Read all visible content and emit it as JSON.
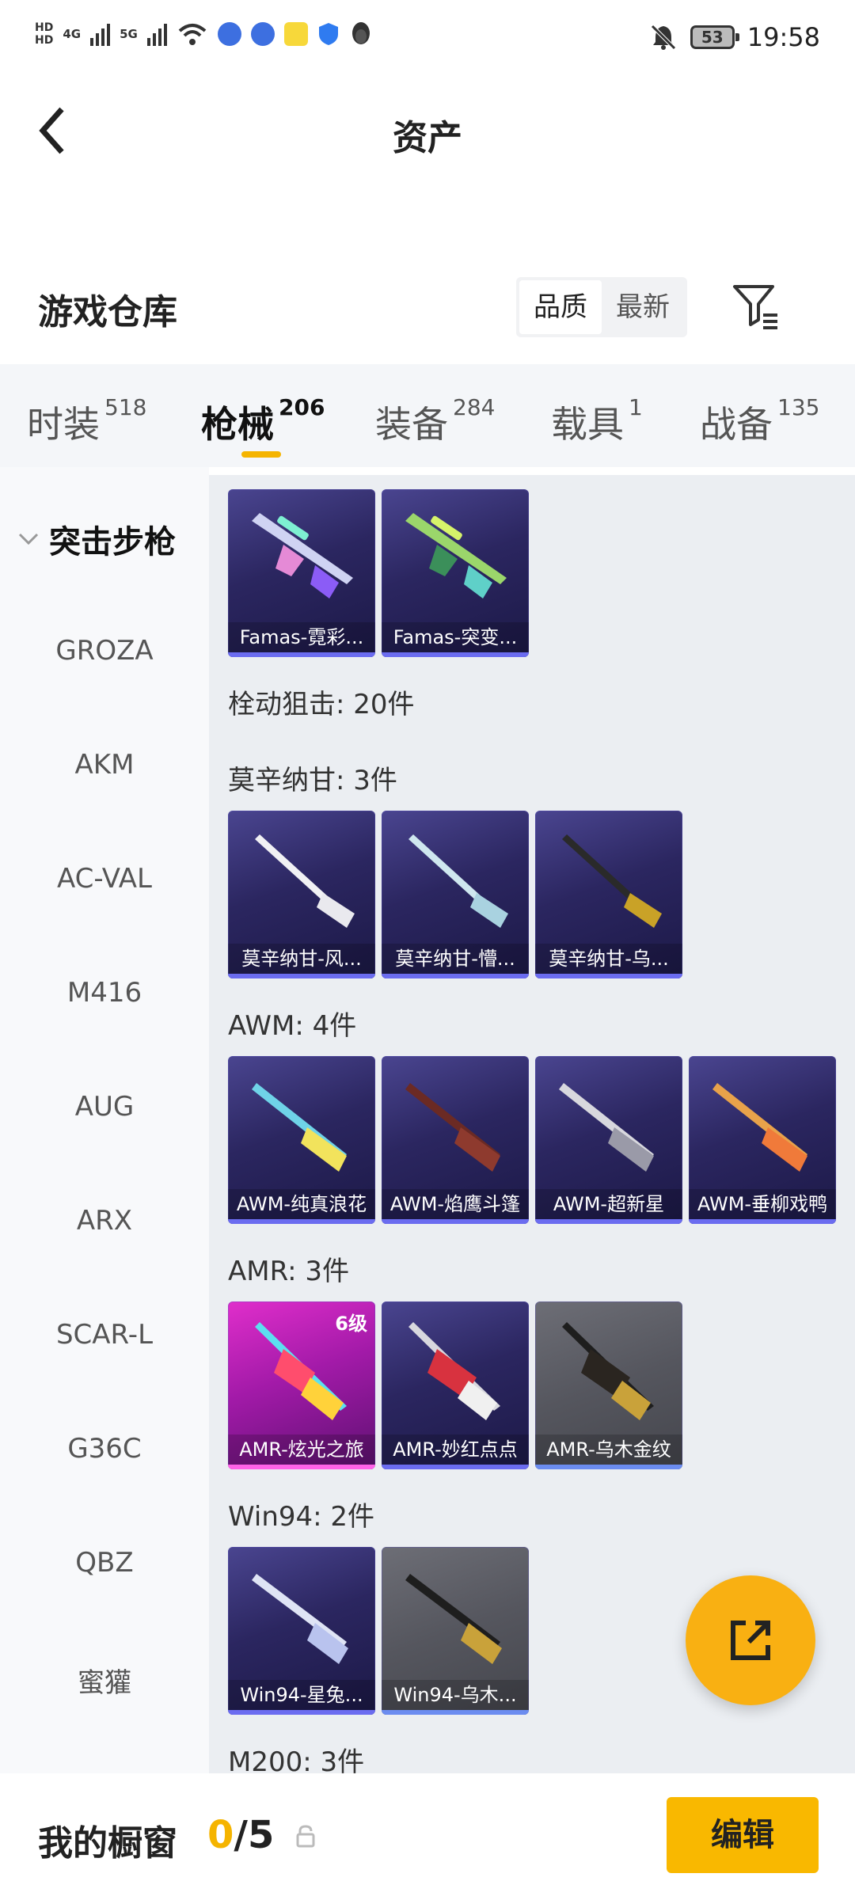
{
  "status_bar": {
    "hd_top": "HD",
    "hd_bottom": "HD",
    "net1": "4G",
    "net2": "5G",
    "battery": "53",
    "time": "19:58"
  },
  "header": {
    "title": "资产"
  },
  "warehouse": {
    "title": "游戏仓库",
    "sort_quality": "品质",
    "sort_newest": "最新"
  },
  "tabs": [
    {
      "label": "时装",
      "count": "518"
    },
    {
      "label": "枪械",
      "count": "206"
    },
    {
      "label": "装备",
      "count": "284"
    },
    {
      "label": "载具",
      "count": "1"
    },
    {
      "label": "战备",
      "count": "135"
    }
  ],
  "sidebar": {
    "category": "突击步枪",
    "items": [
      "GROZA",
      "AKM",
      "AC-VAL",
      "M416",
      "AUG",
      "ARX",
      "SCAR-L",
      "G36C",
      "QBZ",
      "蜜獾"
    ]
  },
  "content": {
    "row1": [
      "Famas-霓彩...",
      "Famas-突变..."
    ],
    "bolt_label": "栓动狙击: 20件",
    "mosin_label": "莫辛纳甘: 3件",
    "mosin": [
      "莫辛纳甘-风...",
      "莫辛纳甘-懵...",
      "莫辛纳甘-乌..."
    ],
    "awm_label": "AWM: 4件",
    "awm": [
      "AWM-纯真浪花",
      "AWM-焰鹰斗篷",
      "AWM-超新星",
      "AWM-垂柳戏鸭"
    ],
    "amr_label": "AMR: 3件",
    "amr": [
      "AMR-炫光之旅",
      "AMR-妙红点点",
      "AMR-乌木金纹"
    ],
    "amr_level": "6级",
    "win94_label": "Win94: 2件",
    "win94": [
      "Win94-星兔...",
      "Win94-乌木..."
    ],
    "m200_label": "M200: 3件"
  },
  "colors": {
    "accent": "#f9b800",
    "tab_indicator": "#f5b400",
    "card_purple": "#2b2660",
    "card_pink": "#c022b8",
    "card_gray": "#5a5b63"
  },
  "bottom_bar": {
    "label": "我的橱窗",
    "count_current": "0",
    "count_sep": "/",
    "count_total": "5",
    "edit": "编辑"
  }
}
